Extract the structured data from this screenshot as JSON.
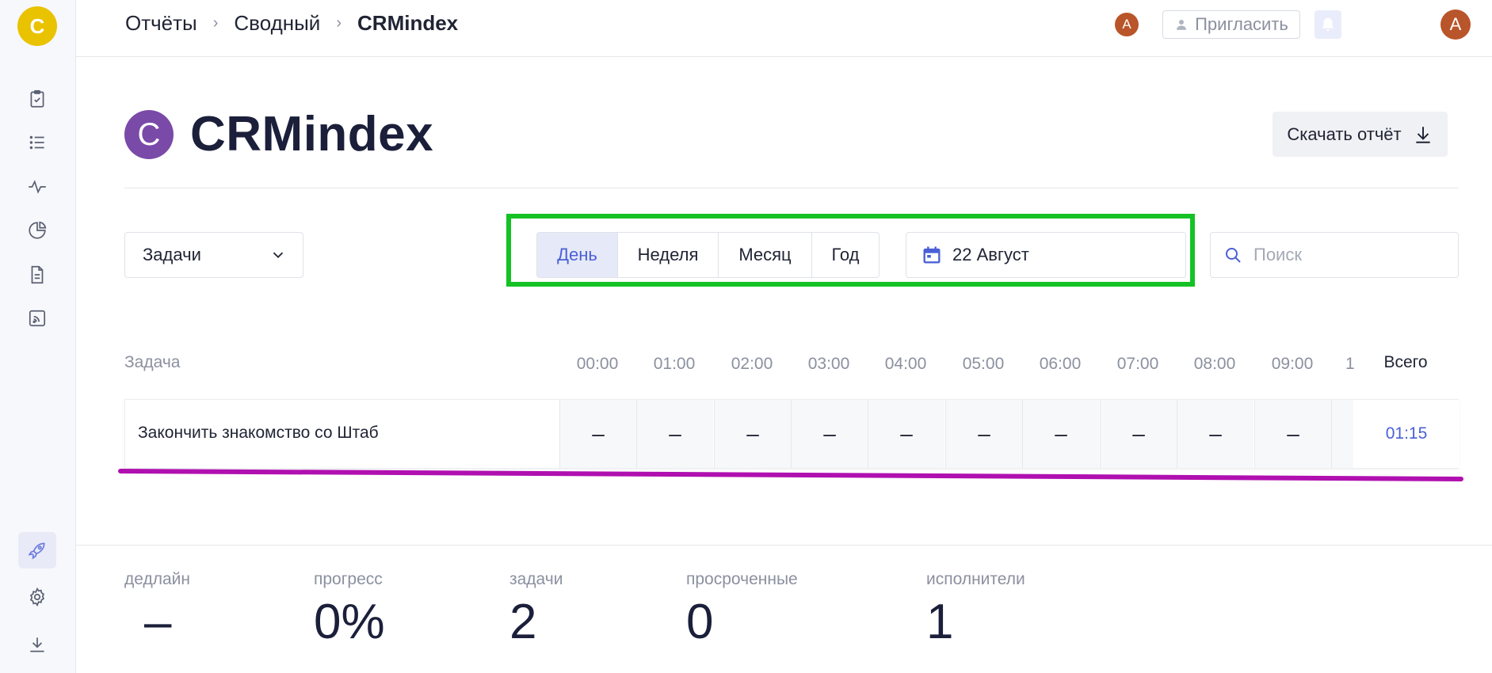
{
  "app": {
    "logo_letter": "C"
  },
  "breadcrumb": [
    "Отчёты",
    "Сводный",
    "CRMindex"
  ],
  "topbar": {
    "mini_avatar": "A",
    "invite_label": "Пригласить",
    "user_avatar": "A"
  },
  "project": {
    "logo_letter": "C",
    "title": "CRMindex",
    "download_label": "Скачать отчёт"
  },
  "filters": {
    "group_select": "Задачи",
    "periods": [
      "День",
      "Неделя",
      "Месяц",
      "Год"
    ],
    "active_period": "День",
    "date": "22 Август",
    "search_placeholder": "Поиск"
  },
  "table": {
    "task_header": "Задача",
    "hours": [
      "00:00",
      "01:00",
      "02:00",
      "03:00",
      "04:00",
      "05:00",
      "06:00",
      "07:00",
      "08:00",
      "09:00",
      "1"
    ],
    "total_header": "Всего",
    "rows": [
      {
        "name": "Закончить знакомство со Штаб",
        "cells": [
          "–",
          "–",
          "–",
          "–",
          "–",
          "–",
          "–",
          "–",
          "–",
          "–",
          ""
        ],
        "total": "01:15"
      }
    ]
  },
  "stats": [
    {
      "label": "дедлайн",
      "value": "–"
    },
    {
      "label": "прогресс",
      "value": "0%"
    },
    {
      "label": "задачи",
      "value": "2"
    },
    {
      "label": "просроченные",
      "value": "0"
    },
    {
      "label": "исполнители",
      "value": "1"
    }
  ],
  "colors": {
    "accent": "#4a5fd6",
    "highlight_box": "#15c225",
    "underline": "#b010b0",
    "logo": "#e9c200",
    "project_logo": "#7a4aa8"
  }
}
